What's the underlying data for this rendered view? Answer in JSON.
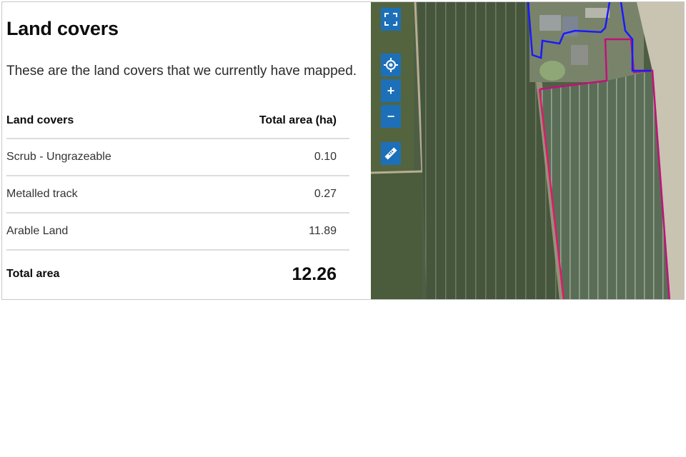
{
  "land_covers": {
    "title": "Land covers",
    "intro": "These are the land covers that we currently have mapped.",
    "table": {
      "col_land_cover": "Land covers",
      "col_area": "Total area (ha)",
      "rows": [
        {
          "name": "Scrub - Ungrazeable",
          "area": "0.10"
        },
        {
          "name": "Metalled track",
          "area": "0.27"
        },
        {
          "name": "Arable Land",
          "area": "11.89"
        }
      ],
      "total_label": "Total area",
      "total_value": "12.26"
    }
  },
  "map": {
    "controls": [
      {
        "icon": "fullscreen-icon"
      },
      {
        "icon": "locate-icon"
      },
      {
        "icon": "zoom-in-icon",
        "symbol": "+"
      },
      {
        "icon": "zoom-out-icon",
        "symbol": "−"
      },
      {
        "icon": "measure-icon"
      }
    ],
    "colors": {
      "control_bg": "#1d70b8",
      "parcel_outline_magenta": "#c0127a",
      "parcel_outline_blue": "#1a1aff"
    }
  }
}
